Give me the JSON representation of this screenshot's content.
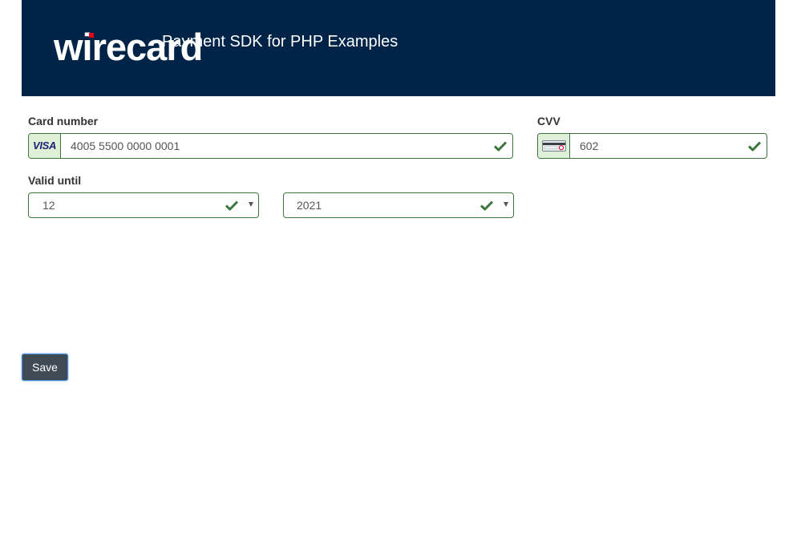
{
  "header": {
    "logo_text": "wirecard",
    "title": "Payment SDK for PHP Examples"
  },
  "form": {
    "card_number": {
      "label": "Card number",
      "brand": "VISA",
      "value": "4005 5500 0000 0001"
    },
    "cvv": {
      "label": "CVV",
      "value": "602"
    },
    "valid_until": {
      "label": "Valid until",
      "month": "12",
      "year": "2021"
    },
    "save_label": "Save"
  },
  "colors": {
    "header_bg": "#002447",
    "valid_border": "#3c763d",
    "addon_bg": "#dff0d8",
    "button_bg": "#3f4a55"
  },
  "icons": {
    "validation": "check-icon",
    "cvv": "card-cvv-icon",
    "select": "caret-down-icon"
  }
}
